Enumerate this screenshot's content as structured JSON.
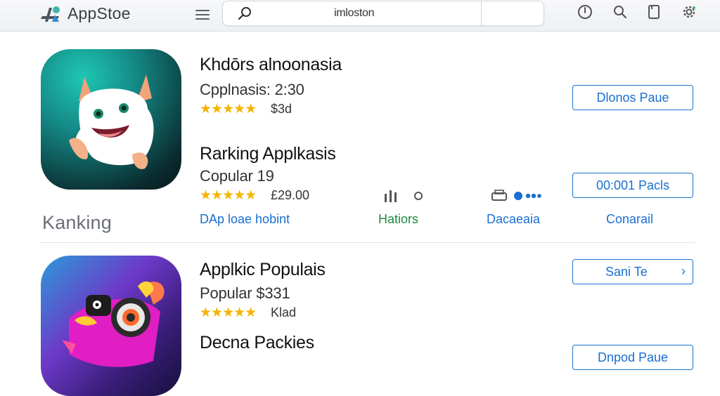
{
  "topbar": {
    "app_name": "AppStoe",
    "search_text": "imloston"
  },
  "apps": [
    {
      "title": "Khdōrs alnoonasia",
      "subtitle": "Cpplnasis: 2:30",
      "rating_text": "$3d",
      "button_label": "Dlonos Paue"
    },
    {
      "title": "Rarking Applkasis",
      "subtitle": "Copular 19",
      "rating_text": "£29.00",
      "button_label": "00:001 Pacls"
    },
    {
      "title": "Applkic Populais",
      "subtitle": "Popular $331",
      "rating_text": "Klad",
      "button_label": "Sani Te"
    },
    {
      "title": "Decna Packies",
      "button_label": "Dnpod Paue"
    }
  ],
  "section": {
    "label": "Kanking"
  },
  "links": {
    "link1": "DAp loae hobint",
    "link2": "Hatiors",
    "link3": "Dacaeaia",
    "link4": "Conarail"
  },
  "icons": {
    "logo": "app-store-logo-icon",
    "menu": "hamburger-menu-icon",
    "search": "search-icon",
    "clock": "clock-icon",
    "search_tb": "search-icon",
    "tablet": "tablet-icon",
    "settings": "gear-icon",
    "stars": "★★★★★"
  },
  "colors": {
    "accent_blue": "#1a6fcf",
    "link_green": "#1f8a3c",
    "star_gold": "#f5b400"
  }
}
